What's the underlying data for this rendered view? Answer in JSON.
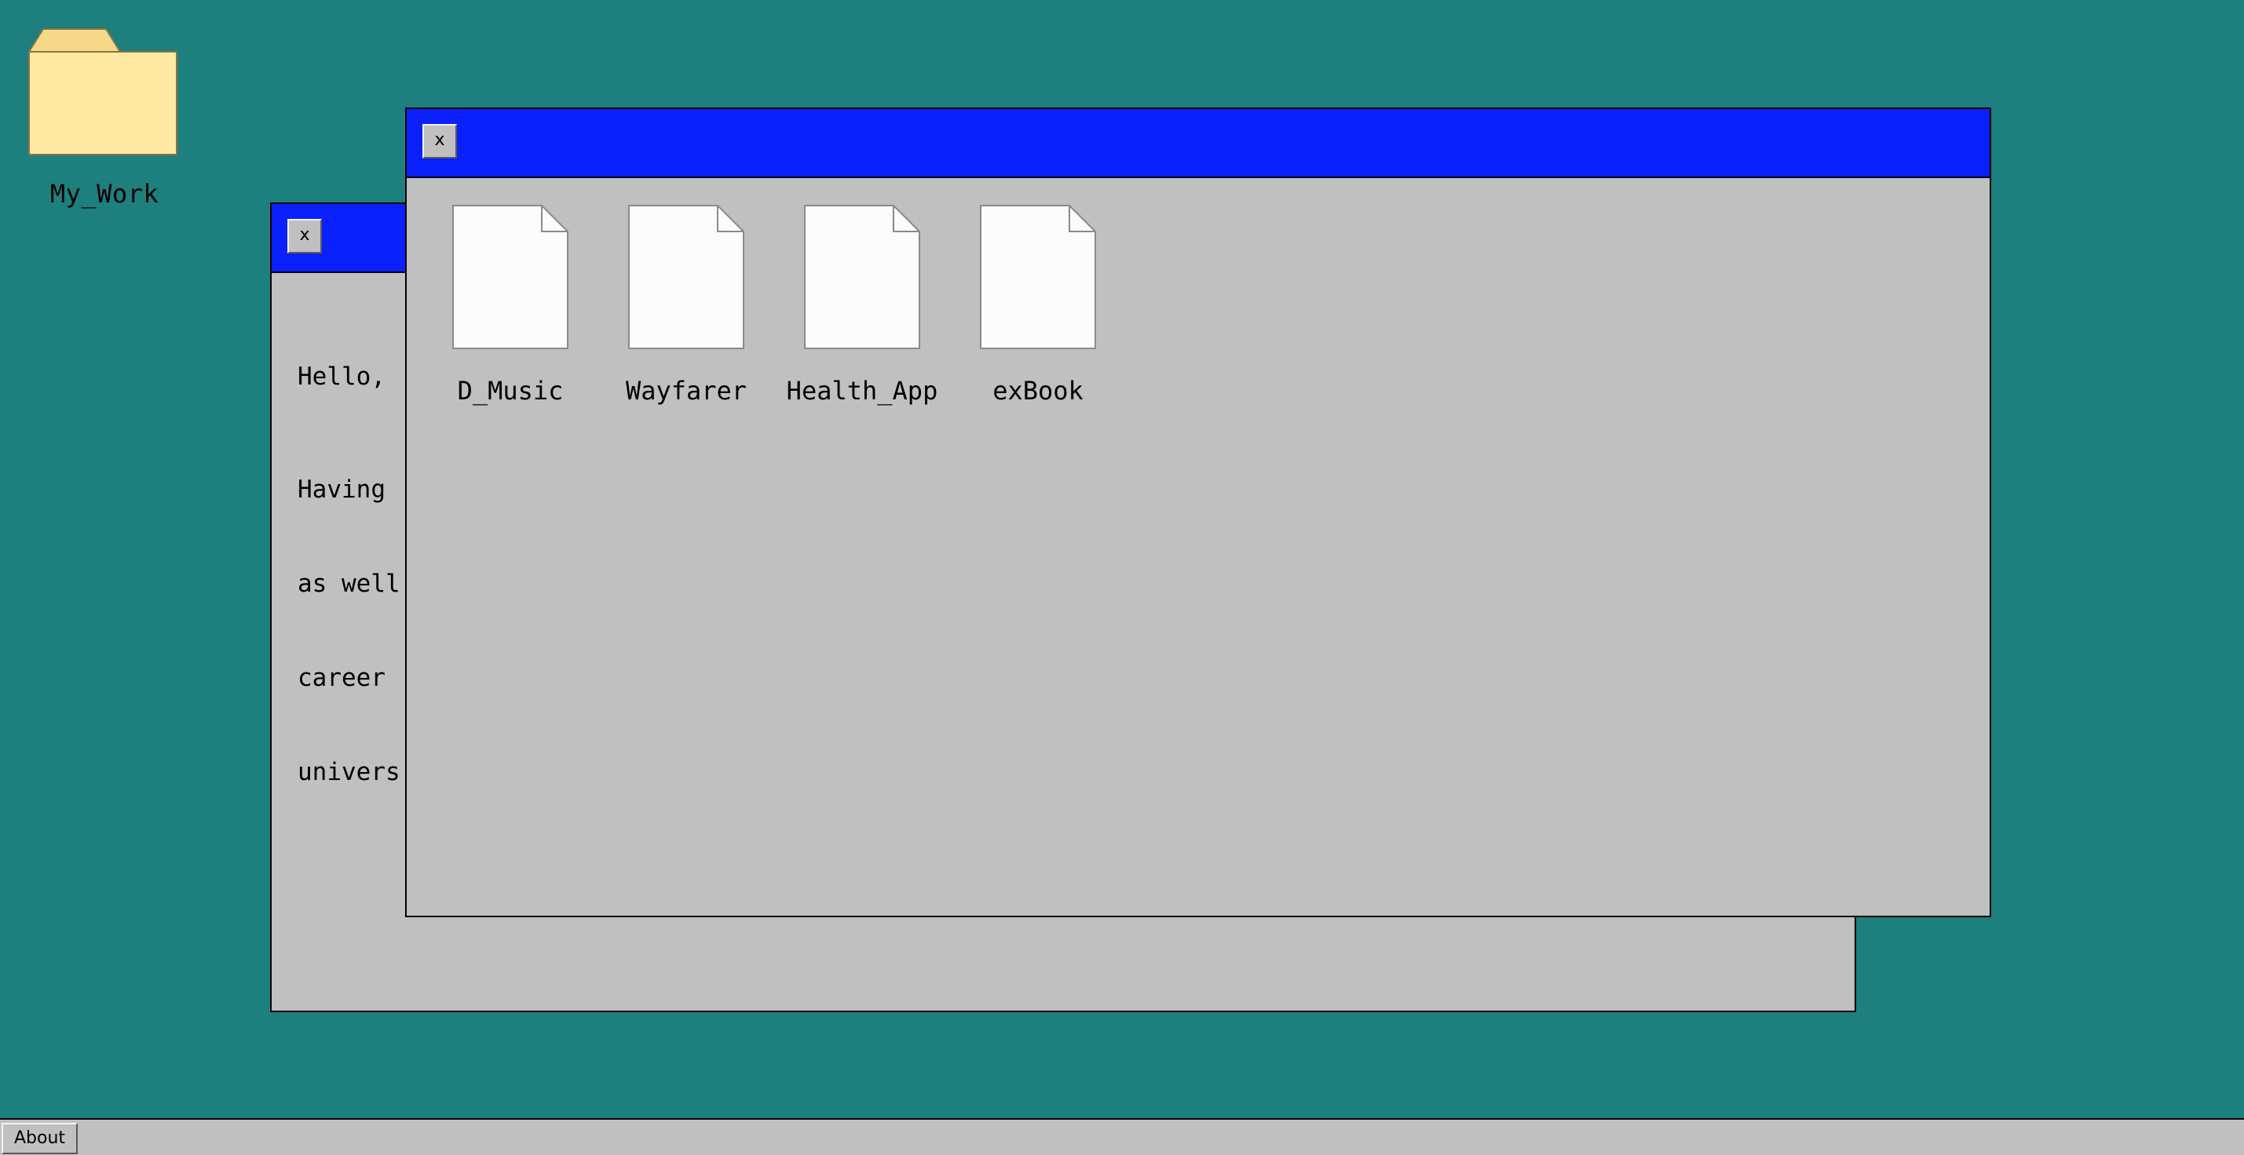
{
  "desktop": {
    "background_color": "#1d7f7e",
    "icons": [
      {
        "label": "My_Work",
        "icon": "folder-icon"
      }
    ]
  },
  "text_window": {
    "close_label": "x",
    "titlebar_color": "#0a21fd",
    "visible_text": {
      "greeting": "Hello, ",
      "line1": "Having ",
      "line2": "as well",
      "line3": "career ",
      "line4": "univers"
    }
  },
  "files_window": {
    "close_label": "x",
    "titlebar_color": "#0a21fd",
    "files": [
      {
        "label": "D_Music",
        "icon": "file-icon"
      },
      {
        "label": "Wayfarer",
        "icon": "file-icon"
      },
      {
        "label": "Health_App",
        "icon": "file-icon"
      },
      {
        "label": "exBook",
        "icon": "file-icon"
      }
    ]
  },
  "taskbar": {
    "about_label": "About"
  }
}
